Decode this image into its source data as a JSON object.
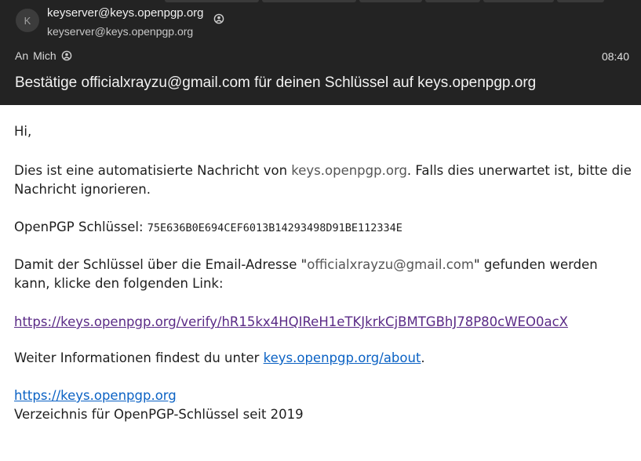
{
  "header": {
    "avatar_letter": "K",
    "sender_name": "keyserver@keys.openpgp.org",
    "sender_email": "keyserver@keys.openpgp.org",
    "to_label": "An",
    "to_name": "Mich",
    "time": "08:40",
    "subject": "Bestätige officialxrayzu@gmail.com für deinen Schlüssel auf keys.openpgp.org"
  },
  "body": {
    "greeting": "Hi,",
    "intro_before": "Dies ist eine automatisierte Nachricht von ",
    "intro_domain": "keys.openpgp.org",
    "intro_after": ". Falls dies unerwartet ist, bitte die Nachricht ignorieren.",
    "key_label": "OpenPGP Schlüssel: ",
    "key_fingerprint": "75E636B0E694CEF6013B14293498D91BE112334E",
    "confirm_before": "Damit der Schlüssel über die Email-Adresse \"",
    "confirm_email": "officialxrayzu@gmail.com",
    "confirm_after": "\" gefunden werden kann, klicke den folgenden Link:",
    "verify_link": "https://keys.openpgp.org/verify/hR15kx4HQIReH1eTKJkrkCjBMTGBhJ78P80cWEO0acX",
    "info_before": "Weiter Informationen findest du unter ",
    "info_link": "keys.openpgp.org/about",
    "info_after": ".",
    "footer_link": "https://keys.openpgp.org",
    "footer_text": "Verzeichnis für OpenPGP-Schlüssel seit 2019"
  }
}
